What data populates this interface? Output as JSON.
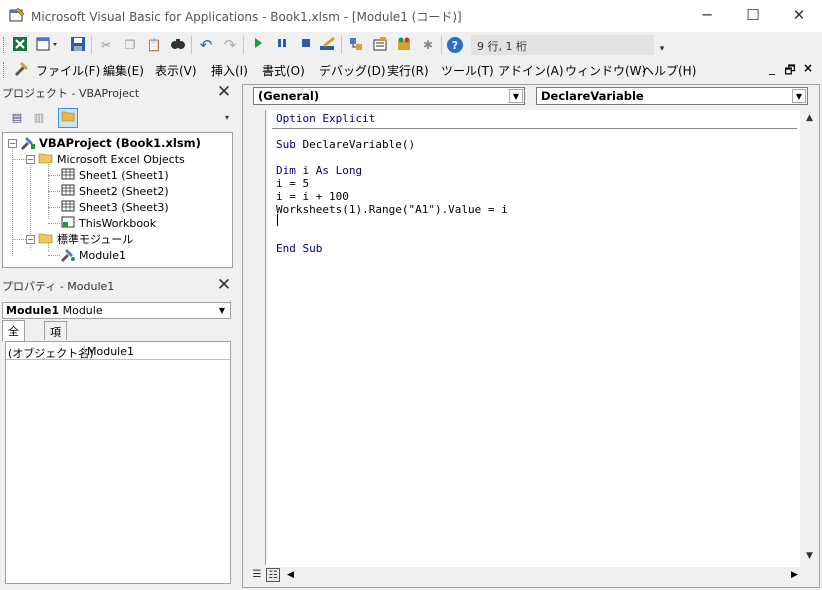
{
  "window": {
    "title": "Microsoft Visual Basic for Applications - Book1.xlsm - [Module1 (コード)]",
    "min_glyph": "─",
    "max_glyph": "☐",
    "close_glyph": "✕"
  },
  "toolbar": {
    "status": "9 行, 1 桁",
    "icons": [
      "excel-view-icon",
      "insert-module-icon",
      "save-icon",
      "cut-icon",
      "copy-icon",
      "paste-icon",
      "find-icon",
      "undo-icon",
      "redo-icon",
      "run-icon",
      "break-icon",
      "reset-icon",
      "design-mode-icon",
      "project-explorer-icon",
      "properties-icon",
      "object-browser-icon",
      "toolbox-icon",
      "help-icon"
    ]
  },
  "menu": {
    "items": [
      {
        "label": "ファイル(F)"
      },
      {
        "label": "編集(E)"
      },
      {
        "label": "表示(V)"
      },
      {
        "label": "挿入(I)"
      },
      {
        "label": "書式(O)"
      },
      {
        "label": "デバッグ(D)"
      },
      {
        "label": "実行(R)"
      },
      {
        "label": "ツール(T)"
      },
      {
        "label": "アドイン(A)"
      },
      {
        "label": "ウィンドウ(W)"
      },
      {
        "label": "ヘルプ(H)"
      }
    ],
    "mdi_min": "_",
    "mdi_restore": "🗗",
    "mdi_close": "×"
  },
  "project": {
    "title": "プロジェクト - VBAProject",
    "close": "✕",
    "tree": {
      "root": "VBAProject (Book1.xlsm)",
      "folder1": "Microsoft Excel Objects",
      "sheet1": "Sheet1 (Sheet1)",
      "sheet2": "Sheet2 (Sheet2)",
      "sheet3": "Sheet3 (Sheet3)",
      "workbook": "ThisWorkbook",
      "folder2": "標準モジュール",
      "module1": "Module1"
    }
  },
  "properties": {
    "title": "プロパティ - Module1",
    "close": "✕",
    "object_name": "Module1",
    "object_type": "Module",
    "tabs": [
      "全体",
      "項目別"
    ],
    "row_key": "(オブジェクト名)",
    "row_value": "Module1"
  },
  "code": {
    "object_combo": "(General)",
    "proc_combo": "DeclareVariable",
    "lines": [
      "Option Explicit",
      "",
      "Sub DeclareVariable()",
      "",
      "Dim i As Long",
      "i = 5",
      "i = i + 100",
      "Worksheets(1).Range(\"A1\").Value = i",
      "",
      "",
      "End Sub"
    ]
  }
}
